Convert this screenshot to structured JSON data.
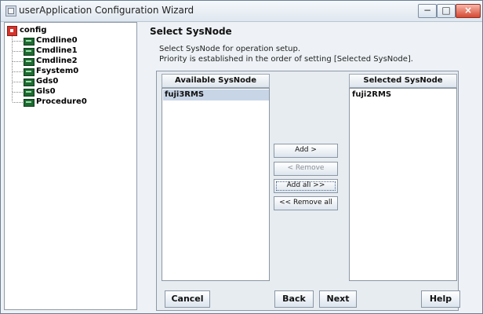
{
  "window": {
    "title": "userApplication Configuration Wizard",
    "controls": {
      "minimize": "−",
      "maximize": "□",
      "close": "×"
    }
  },
  "tree": {
    "root": "config",
    "children": [
      "Cmdline0",
      "Cmdline1",
      "Cmdline2",
      "Fsystem0",
      "Gds0",
      "Gls0",
      "Procedure0"
    ]
  },
  "page": {
    "title": "Select SysNode",
    "description_line1": "Select SysNode for operation setup.",
    "description_line2": "Priority is established in the order of setting [Selected SysNode]."
  },
  "available": {
    "header": "Available SysNode",
    "items": [
      "fuji3RMS"
    ]
  },
  "selected": {
    "header": "Selected SysNode",
    "items": [
      "fuji2RMS"
    ]
  },
  "middle_buttons": {
    "add": "Add >",
    "remove": "< Remove",
    "add_all": "Add all >>",
    "remove_all": "<< Remove all"
  },
  "footer_buttons": {
    "cancel": "Cancel",
    "back": "Back",
    "next": "Next",
    "help": "Help"
  }
}
